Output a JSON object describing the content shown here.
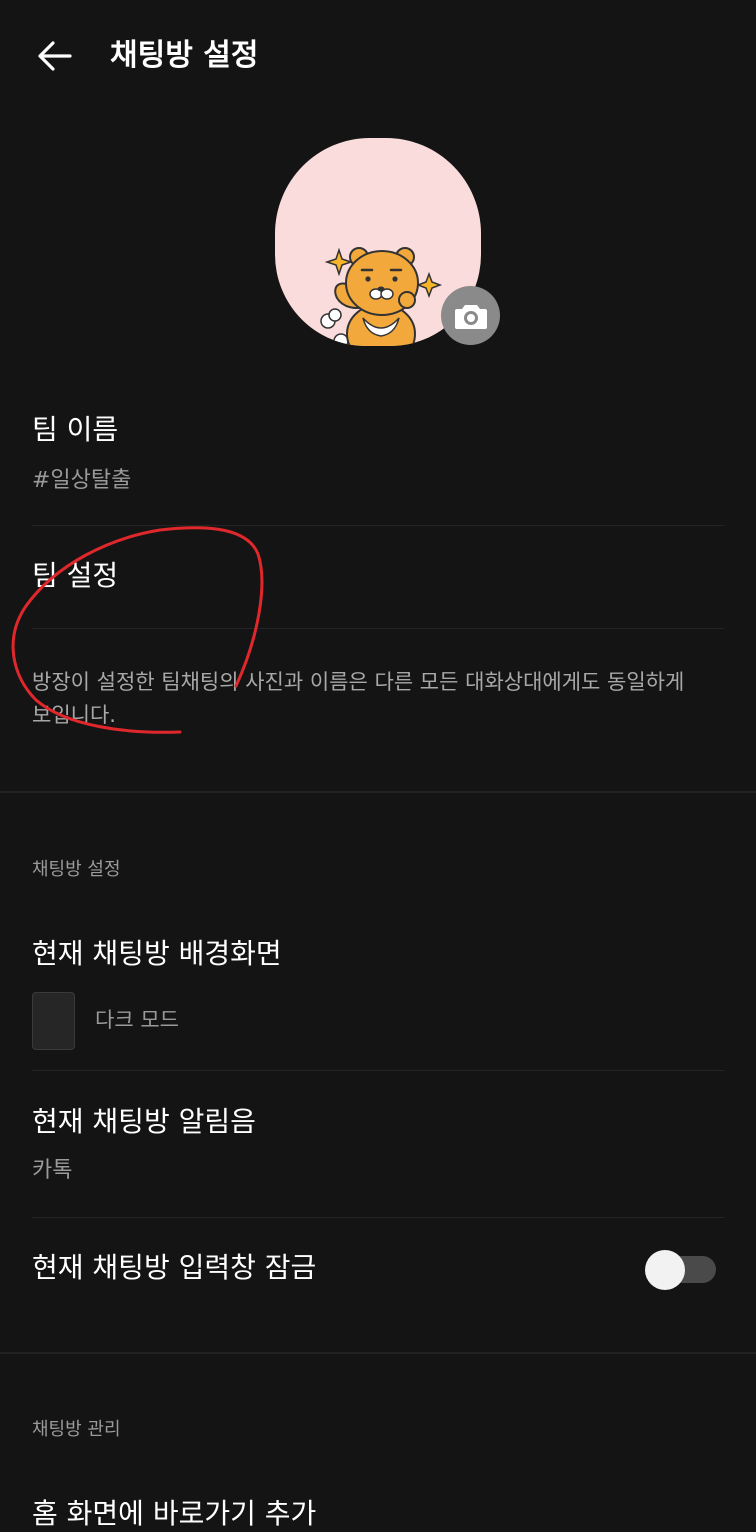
{
  "header": {
    "title": "채팅방 설정"
  },
  "profile": {
    "image": "ryan-character",
    "camera_icon": "camera-icon"
  },
  "team_name": {
    "label": "팀 이름",
    "value": "#일상탈출"
  },
  "team_settings": {
    "label": "팀 설정"
  },
  "description": "방장이 설정한 팀채팅의 사진과 이름은 다른 모든 대화상대에게도 동일하게 보입니다.",
  "chat_settings": {
    "section_label": "채팅방 설정",
    "background": {
      "label": "현재 채팅방 배경화면",
      "value": "다크 모드"
    },
    "notification": {
      "label": "현재 채팅방 알림음",
      "value": "카톡"
    },
    "input_lock": {
      "label": "현재 채팅방 입력창 잠금",
      "enabled": false
    }
  },
  "chat_management": {
    "section_label": "채팅방 관리",
    "shortcut": {
      "label": "홈 화면에 바로가기 추가"
    }
  },
  "colors": {
    "background": "#141414",
    "profile_bg": "#fbdcdc",
    "annotation": "#e0282c"
  }
}
